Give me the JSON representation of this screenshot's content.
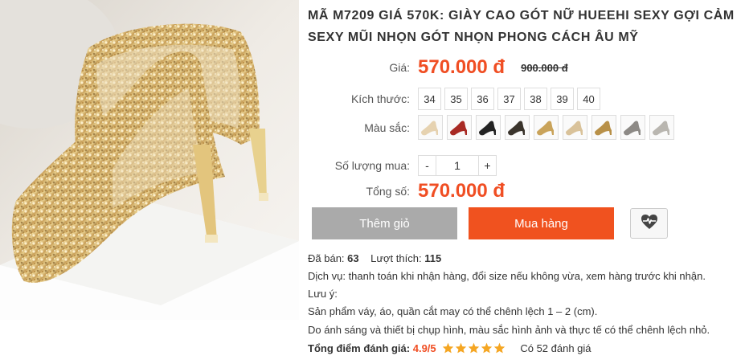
{
  "product": {
    "image_alt": "Giày cao gót nhũ vàng",
    "title": "MÃ M7209 GIÁ 570K: GIÀY CAO GÓT NỮ HUEEHI SEXY GỢI CẢM SEXY MŨI NHỌN GÓT NHỌN PHONG CÁCH ÂU MỸ"
  },
  "price": {
    "label": "Giá:",
    "current": "570.000 đ",
    "old": "900.000 đ"
  },
  "size": {
    "label": "Kích thước:",
    "options": [
      "34",
      "35",
      "36",
      "37",
      "38",
      "39",
      "40"
    ]
  },
  "color": {
    "label": "Màu sắc:",
    "swatches": [
      {
        "name": "champagne",
        "hex": "#e6d2b0"
      },
      {
        "name": "red",
        "hex": "#a82a24"
      },
      {
        "name": "black",
        "hex": "#222222"
      },
      {
        "name": "black-gold",
        "hex": "#3a342c"
      },
      {
        "name": "gold",
        "hex": "#c9a35a"
      },
      {
        "name": "light-gold",
        "hex": "#d9c29a"
      },
      {
        "name": "gold-2",
        "hex": "#b89048"
      },
      {
        "name": "silver-gray",
        "hex": "#8d8a86"
      },
      {
        "name": "silver",
        "hex": "#b9b6b0"
      }
    ]
  },
  "quantity": {
    "label": "Số lượng mua:",
    "minus": "-",
    "value": "1",
    "plus": "+"
  },
  "total": {
    "label": "Tổng số:",
    "value": "570.000 đ"
  },
  "actions": {
    "add_to_cart": "Thêm giỏ",
    "buy_now": "Mua hàng",
    "favorite_icon": "heart-pulse-icon"
  },
  "stats": {
    "sold_label": "Đã bán:",
    "sold_value": "63",
    "likes_label": "Lượt thích:",
    "likes_value": "115"
  },
  "notes": {
    "service": "Dịch vụ: thanh toán khi nhận hàng, đổi size nếu không vừa, xem hàng trước khi nhận.",
    "note_title": "Lưu ý:",
    "note_1": "Sản phẩm váy, áo, quần cắt may có thể chênh lệch 1 – 2 (cm).",
    "note_2": "Do ánh sáng và thiết bị chụp hình, màu sắc hình ảnh và thực tế có thể chênh lệch nhỏ."
  },
  "rating": {
    "label": "Tổng điểm đánh giá:",
    "value": "4.9/5",
    "stars": 4.9,
    "star_color": "#f5a623",
    "count_text": "Có 52 đánh giá"
  },
  "colors": {
    "accent": "#f04e23",
    "cart_button": "#aaaaaa",
    "buy_button": "#f0521f"
  }
}
